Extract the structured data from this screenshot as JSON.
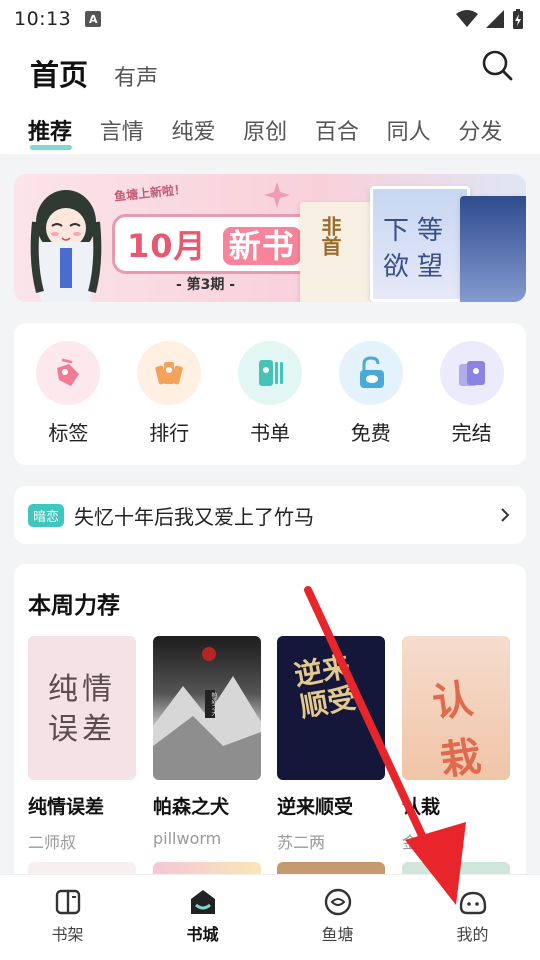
{
  "status_bar": {
    "time": "10:13",
    "notification_letter": "A"
  },
  "header": {
    "title": "首页",
    "sub_tab": "有声",
    "categories": [
      {
        "label": "推荐",
        "active": true
      },
      {
        "label": "言情"
      },
      {
        "label": "纯爱"
      },
      {
        "label": "原创"
      },
      {
        "label": "百合"
      },
      {
        "label": "同人"
      },
      {
        "label": "分发"
      }
    ]
  },
  "banner": {
    "caption": "鱼塘上新啦！",
    "month": "10月",
    "headline": "新书",
    "issue": "- 第3期 -",
    "book_titles": [
      "非首",
      "下等欲望"
    ]
  },
  "quick_entries": [
    {
      "label": "标签",
      "icon": "tag-icon",
      "bg": "#fde8ee",
      "color": "#f07b95"
    },
    {
      "label": "排行",
      "icon": "ranking-icon",
      "bg": "#fff0e3",
      "color": "#f3a25c"
    },
    {
      "label": "书单",
      "icon": "booklist-icon",
      "bg": "#e2f6f4",
      "color": "#45c3b9"
    },
    {
      "label": "免费",
      "icon": "free-icon",
      "bg": "#e3f2fb",
      "color": "#49a9d8"
    },
    {
      "label": "完结",
      "icon": "completed-icon",
      "bg": "#ecebfb",
      "color": "#8b83e0"
    }
  ],
  "notice": {
    "badge": "暗恋",
    "text": "失忆十年后我又爱上了竹马"
  },
  "weekly": {
    "title": "本周力荐",
    "books": [
      {
        "name": "纯情误差",
        "author": "二师叔",
        "cover_text": "纯情误差"
      },
      {
        "name": "帕森之犬",
        "author": "pillworm",
        "cover_text": "帕森之犬"
      },
      {
        "name": "逆来顺受",
        "author": "苏二两",
        "cover_text": "逆来顺受"
      },
      {
        "name": "认栽",
        "author": "金",
        "cover_text": "认栽"
      }
    ]
  },
  "bottom_nav": [
    {
      "label": "书架",
      "icon": "bookshelf-icon"
    },
    {
      "label": "书城",
      "icon": "bookstore-icon",
      "active": true
    },
    {
      "label": "鱼塘",
      "icon": "fishpond-icon"
    },
    {
      "label": "我的",
      "icon": "profile-icon"
    }
  ],
  "colors": {
    "accent": "#7ed8d2",
    "badge": "#3fc6c0",
    "overlay_arrow": "#e8252b"
  }
}
